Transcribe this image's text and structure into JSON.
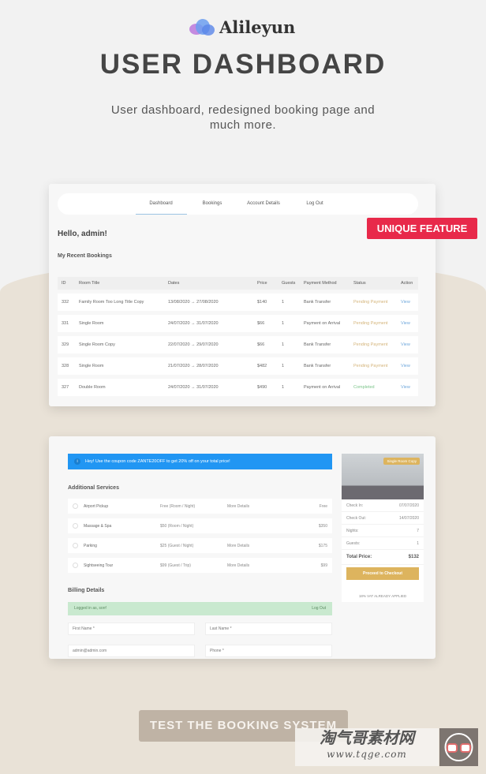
{
  "brand": {
    "logo_text": "Alileyun",
    "title": "USER DASHBOARD",
    "subtitle": "User dashboard, redesigned booking page and much more."
  },
  "dashboard": {
    "nav": [
      "Dashboard",
      "Bookings",
      "Account Details",
      "Log Out"
    ],
    "active_tab": "Dashboard",
    "greeting": "Hello, admin!",
    "section_title": "My Recent Bookings",
    "columns": [
      "ID",
      "Room Title",
      "Dates",
      "Price",
      "Guests",
      "Payment Method",
      "Status",
      "Action"
    ],
    "rows": [
      [
        "332",
        "Family Room Too Long Title Copy",
        "13/08/2020 → 27/08/2020",
        "$140",
        "1",
        "Bank Transfer",
        "Pending Payment",
        "View"
      ],
      [
        "331",
        "Single Room",
        "24/07/2020 → 31/07/2020",
        "$66",
        "1",
        "Payment on Arrival",
        "Pending Payment",
        "View"
      ],
      [
        "329",
        "Single Room Copy",
        "22/07/2020 → 29/07/2020",
        "$66",
        "1",
        "Bank Transfer",
        "Pending Payment",
        "View"
      ],
      [
        "328",
        "Single Room",
        "21/07/2020 → 28/07/2020",
        "$482",
        "1",
        "Bank Transfer",
        "Pending Payment",
        "View"
      ],
      [
        "327",
        "Double Room",
        "24/07/2020 → 31/07/2020",
        "$490",
        "1",
        "Payment on Arrival",
        "Completed",
        "View"
      ]
    ],
    "badge": "UNIQUE FEATURE"
  },
  "booking": {
    "coupon": "Hey! Use the coupon code ZANTE20OFF to get 20% off on your total price!",
    "services_title": "Additional Services",
    "services": [
      {
        "name": "Airport Pickup",
        "rate": "Free (Room / Night)",
        "details": "More Details",
        "price": "Free"
      },
      {
        "name": "Massage & Spa",
        "rate": "$50 (Room / Night)",
        "details": "",
        "price": "$350"
      },
      {
        "name": "Parking",
        "rate": "$25 (Guest / Night)",
        "details": "More Details",
        "price": "$175"
      },
      {
        "name": "Sightseeing Tour",
        "rate": "$99 (Guest / Trip)",
        "details": "More Details",
        "price": "$99"
      }
    ],
    "billing_title": "Billing Details",
    "logged_in": "Logged in as, sorr!",
    "logout": "Log Out",
    "first_name_placeholder": "First Name *",
    "last_name_placeholder": "Last Name *",
    "email_value": "admin@admin.com",
    "phone_placeholder": "Phone *",
    "summary": {
      "room_tag": "Single Room Copy",
      "rows": [
        [
          "Check In:",
          "07/07/2020"
        ],
        [
          "Check Out:",
          "14/07/2020"
        ],
        [
          "Nights:",
          "7"
        ],
        [
          "Guests:",
          "1"
        ]
      ],
      "total_label": "Total Price:",
      "total": "$132",
      "checkout": "Proceed to Checkout",
      "vat": "18% VAT ALREADY APPLIED"
    }
  },
  "cta": "TEST THE BOOKING SYSTEM",
  "watermark": {
    "line1": "淘气哥素材网",
    "line2": "www.tqge.com"
  },
  "colors": {
    "badge": "#e8294a",
    "coupon": "#2196f3",
    "gold": "#ddb45e",
    "pending": "#d4b47a",
    "completed": "#7cc48a"
  }
}
